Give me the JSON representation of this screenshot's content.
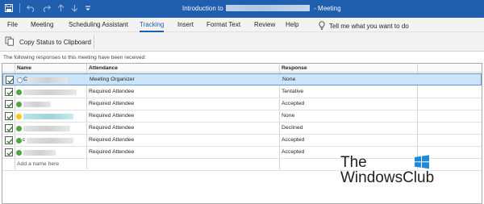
{
  "window": {
    "title_prefix": "Introduction to",
    "title_suffix": "- Meeting"
  },
  "ribbon": {
    "tabs": [
      {
        "label": "File"
      },
      {
        "label": "Meeting"
      },
      {
        "label": "Scheduling Assistant"
      },
      {
        "label": "Tracking",
        "active": true
      },
      {
        "label": "Insert"
      },
      {
        "label": "Format Text"
      },
      {
        "label": "Review"
      },
      {
        "label": "Help"
      }
    ],
    "tell_me": "Tell me what you want to do"
  },
  "commands": {
    "copy_status": "Copy Status to Clipboard"
  },
  "info_text": "The following responses to this meeting have been received:",
  "table": {
    "headers": {
      "name": "Name",
      "attendance": "Attendance",
      "response": "Response"
    },
    "rows": [
      {
        "name_prefix": "C",
        "attendance": "Meeting Organizer",
        "response": "None",
        "status": "grey",
        "selected": true
      },
      {
        "name_prefix": "",
        "attendance": "Required Attendee",
        "response": "Tentative",
        "status": "green"
      },
      {
        "name_prefix": "",
        "attendance": "Required Attendee",
        "response": "Accepted",
        "status": "green"
      },
      {
        "name_prefix": "",
        "attendance": "Required Attendee",
        "response": "None",
        "status": "yellow"
      },
      {
        "name_prefix": "",
        "attendance": "Required Attendee",
        "response": "Declined",
        "status": "green"
      },
      {
        "name_prefix": "c",
        "attendance": "Required Attendee",
        "response": "Accepted",
        "status": "green"
      },
      {
        "name_prefix": "",
        "attendance": "Required Attendee",
        "response": "Accepted",
        "status": "green"
      }
    ],
    "add_name_placeholder": "Add a name here"
  },
  "watermark": {
    "line1": "The",
    "line2": "WindowsClub"
  },
  "colors": {
    "accent": "#1f5fae",
    "selection": "#cde3f8",
    "accepted_green": "#53a244",
    "pending_yellow": "#f2c811"
  }
}
